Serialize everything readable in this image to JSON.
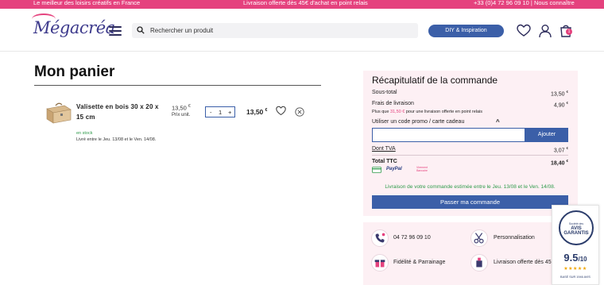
{
  "topbar": {
    "left": "Le meilleur des loisirs créatifs en France",
    "center": "Livraison offerte dès 45€ d'achat en point relais",
    "right": "+33 (0)4 72 96 09 10 | Nous connaître",
    "bg_color": "#e5427e"
  },
  "header": {
    "logo_text": "Mégacréa",
    "search_placeholder": "Rechercher un produit",
    "diy_button": "DIY & Inspiration",
    "cart_count": "1",
    "icons": [
      "menu-icon",
      "search-icon",
      "heart-icon",
      "user-icon",
      "cart-icon"
    ]
  },
  "cart": {
    "title": "Mon panier",
    "item": {
      "name": "Valisette en bois 30 x 20 x 15 cm",
      "unit_price": "13,50",
      "unit_price_currency": "€",
      "unit_label": "Prix unit.",
      "qty_minus": "-",
      "qty": "1",
      "qty_plus": "+",
      "total_price": "13,50",
      "total_currency": "€",
      "stock": "en stock",
      "delivery": "Livré entre le Jeu. 13/08 et le Ven. 14/08."
    }
  },
  "summary": {
    "title": "Récapitulatif de la commande",
    "subtotal_label": "Sous-total",
    "subtotal_value": "13,50",
    "shipping_label": "Frais de livraison",
    "shipping_value": "4,90",
    "remaining_prefix": "Plus que",
    "remaining_amount": "31,50 €",
    "remaining_suffix": "pour une livraison offerte en point relais",
    "promo_label": "Utiliser un code promo / carte cadeau",
    "promo_button": "Ajouter",
    "tva_label": "Dont TVA",
    "tva_value": "3,07",
    "total_label": "Total TTC",
    "total_value": "18,40",
    "currency": "€",
    "payments": [
      "PayPal",
      "Virement Bancaire"
    ],
    "estimate": "Livraison de votre commande estimée entre le Jeu. 13/08 et le Ven. 14/08.",
    "checkout_button": "Passer ma commande"
  },
  "services": [
    {
      "icon": "phone-icon",
      "label": "04 72 96 09 10"
    },
    {
      "icon": "scissors-icon",
      "label": "Personnalisation"
    },
    {
      "icon": "gift-icon",
      "label": "Fidélité & Parrainage"
    },
    {
      "icon": "package-icon",
      "label": "Livraison offerte dès 45"
    }
  ],
  "avis": {
    "seal_top": "Société des",
    "seal_main": "AVIS GARANTIS",
    "score": "9.5",
    "score_max": "/10",
    "stars": "★★★★★",
    "based_on": "BASÉ SUR 1946 AVIS"
  }
}
